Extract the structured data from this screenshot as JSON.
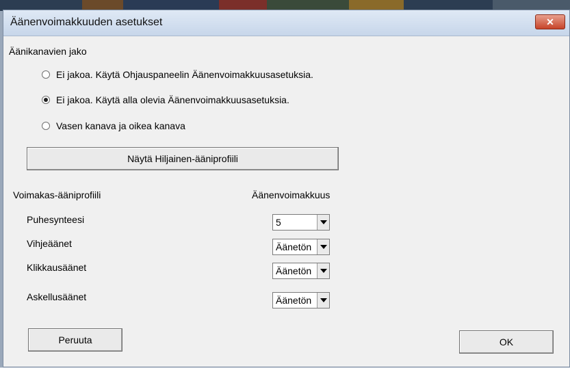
{
  "window": {
    "title": "Äänenvoimakkuuden asetukset",
    "close_glyph": "✕"
  },
  "channel_split": {
    "heading": "Äänikanavien jako",
    "options": [
      {
        "label": "Ei jakoa. Käytä Ohjauspaneelin Äänenvoimakkuusasetuksia.",
        "checked": false
      },
      {
        "label": "Ei jakoa. Käytä alla olevia Äänenvoimakkuusasetuksia.",
        "checked": true
      },
      {
        "label": "Vasen kanava ja oikea kanava",
        "checked": false
      }
    ]
  },
  "quiet_profile_button": "Näytä Hiljainen-ääniprofiili",
  "loud_profile": {
    "heading": "Voimakas-ääniprofiili",
    "volume_heading": "Äänenvoimakkuus",
    "rows": [
      {
        "label": "Puhesynteesi",
        "value": "5"
      },
      {
        "label": "Vihjeäänet",
        "value": "Äänetön"
      },
      {
        "label": "Klikkausäänet",
        "value": "Äänetön"
      },
      {
        "label": "Askellusäänet",
        "value": "Äänetön"
      }
    ]
  },
  "footer": {
    "cancel_label": "Peruuta",
    "ok_label": "OK"
  },
  "colors": {
    "dialog_bg": "#f0f0f0",
    "close_button": "#c7442a"
  },
  "icons": {
    "close": "close-icon",
    "dropdown": "chevron-down-icon"
  }
}
